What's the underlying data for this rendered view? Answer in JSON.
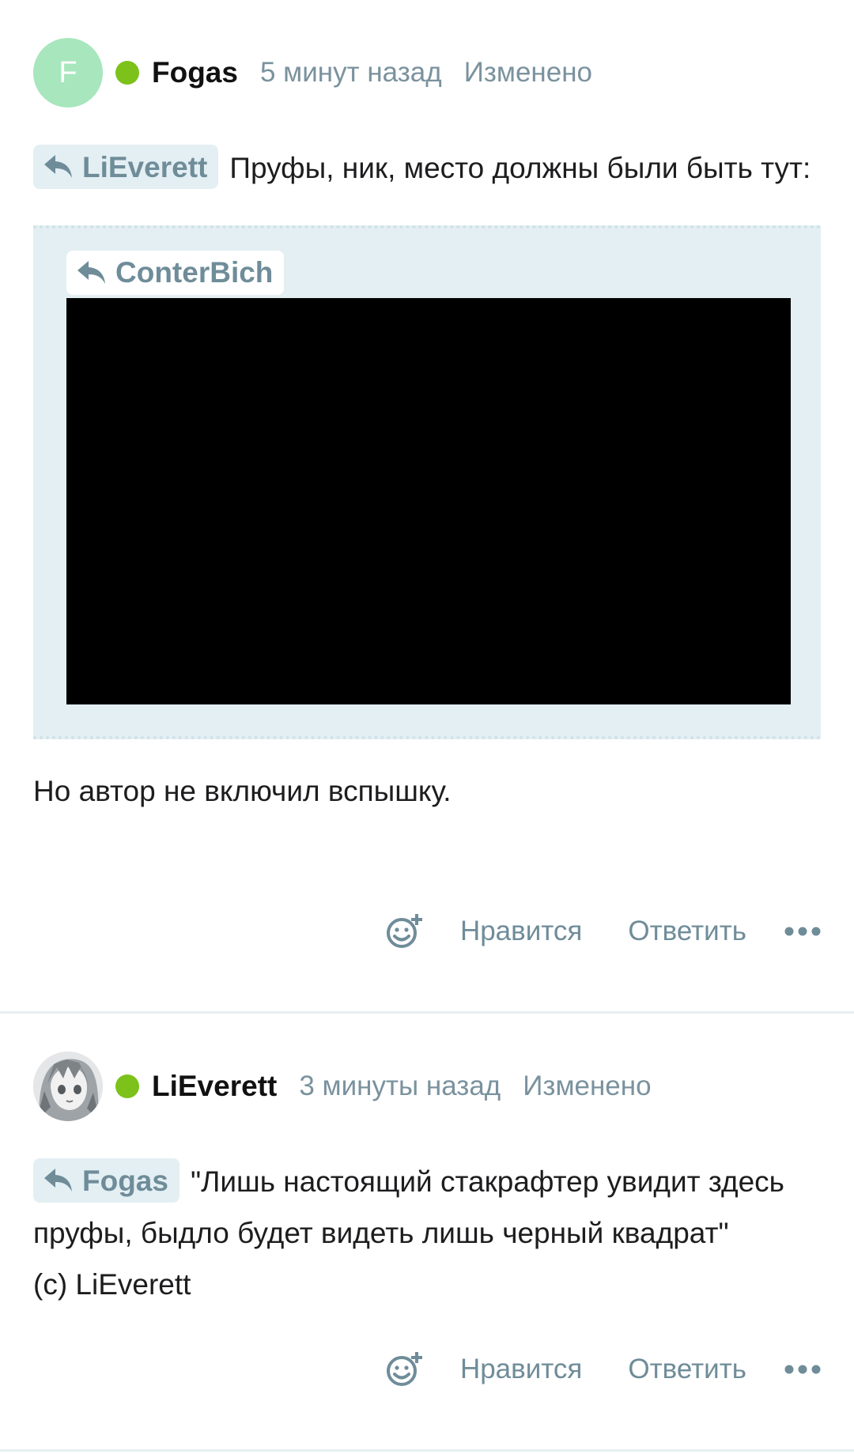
{
  "comments": [
    {
      "avatar_letter": "F",
      "username": "Fogas",
      "time": "5 минут назад",
      "edited": "Изменено",
      "reply_to": "LiEverett",
      "text": "Пруфы, ник, место должны были быть тут:",
      "quote": {
        "reply_to": "ConterBich"
      },
      "after_text": "Но автор не включил вспышку.",
      "actions": {
        "like": "Нравится",
        "reply": "Ответить"
      }
    },
    {
      "username": "LiEverett",
      "time": "3 минуты назад",
      "edited": "Изменено",
      "reply_to": "Fogas",
      "text": "\"Лишь настоящий стакрафтер увидит здесь пруфы, быдло будет видеть лишь черный квадрат\"",
      "text_line2": "(c) LiEverett",
      "actions": {
        "like": "Нравится",
        "reply": "Ответить"
      }
    }
  ],
  "colors": {
    "online": "#7cc21a",
    "accent_text": "#6f8c99",
    "chip_bg": "#e3eff3",
    "avatar_bg": "#a8e6bd"
  },
  "icons": {
    "reply": "reply-arrow-icon",
    "emoji": "add-reaction-icon",
    "more": "more-dots-icon"
  }
}
